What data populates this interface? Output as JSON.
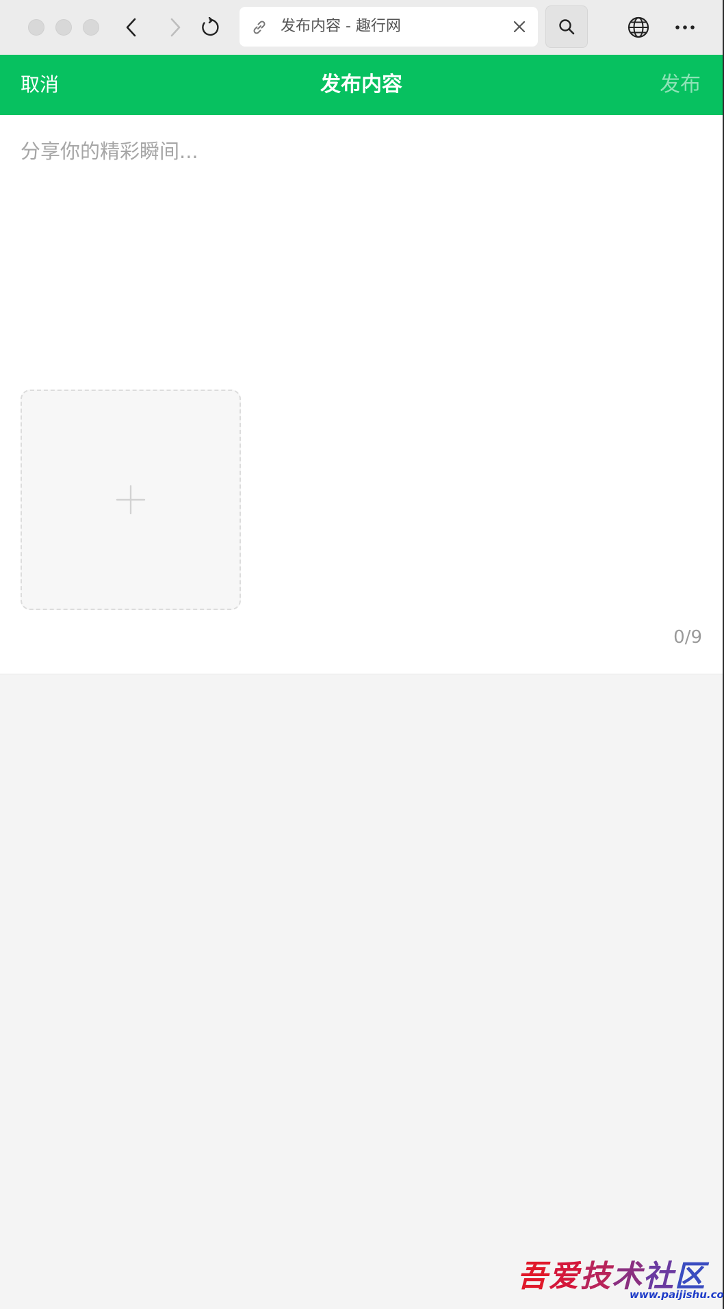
{
  "browser": {
    "tab_title": "发布内容 - 趣行网",
    "icons": {
      "back": "chevron-left-icon",
      "forward": "chevron-right-icon",
      "reload": "reload-icon",
      "link": "link-icon",
      "close": "close-icon",
      "search": "search-icon",
      "globe": "globe-icon",
      "more": "more-icon"
    }
  },
  "header": {
    "cancel_label": "取消",
    "title": "发布内容",
    "publish_label": "发布",
    "background_color": "#07c160"
  },
  "editor": {
    "placeholder": "分享你的精彩瞬间...",
    "value": "",
    "upload_icon": "plus-icon",
    "image_count": "0/9"
  },
  "watermark": {
    "text": "吾爱技术社区",
    "url": "www.paijishu.com"
  }
}
